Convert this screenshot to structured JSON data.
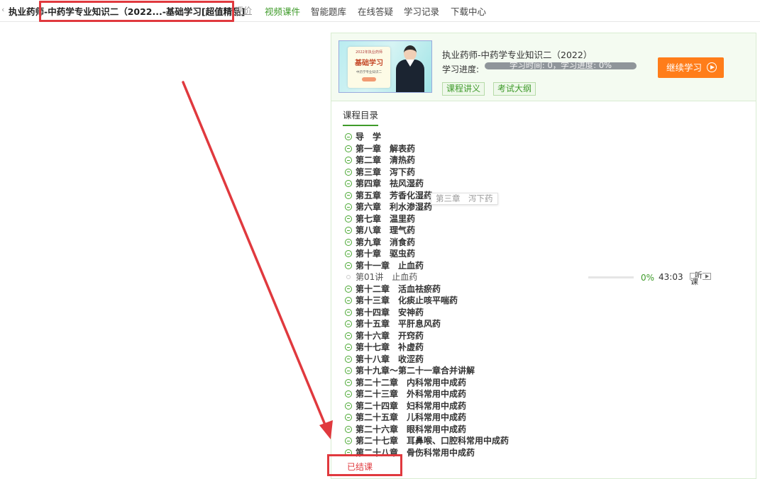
{
  "topbar": {
    "back_icon": "chevron-left-icon",
    "title": "执业药师-中药学专业知识二（2022...-基础学习[超值精品]",
    "eval": "评价",
    "nav": [
      {
        "label": "视频课件",
        "active": true
      },
      {
        "label": "智能题库",
        "active": false
      },
      {
        "label": "在线答疑",
        "active": false
      },
      {
        "label": "学习记录",
        "active": false
      },
      {
        "label": "下载中心",
        "active": false
      }
    ]
  },
  "course": {
    "thumb": {
      "line1": "2022年执业药师",
      "line2": "基础学习",
      "line3": "中药学专业知识二"
    },
    "name": "执业药师-中药学专业知识二（2022）",
    "progress_label": "学习进度:",
    "progress_text": "学习时间: 0，学习进度: 0%",
    "progress_percent": 0,
    "tags": [
      "课程讲义",
      "考试大纲"
    ],
    "continue_label": "继续学习",
    "continue_icon": "play-circle-icon"
  },
  "catalog": {
    "tab_label": "课程目录",
    "tooltip": "第三章　泻下药",
    "chapters": [
      {
        "title": "导　学"
      },
      {
        "title": "第一章　解表药"
      },
      {
        "title": "第二章　清热药"
      },
      {
        "title": "第三章　泻下药"
      },
      {
        "title": "第四章　祛风湿药"
      },
      {
        "title": "第五章　芳香化湿药"
      },
      {
        "title": "第六章　利水渗湿药"
      },
      {
        "title": "第七章　温里药"
      },
      {
        "title": "第八章　理气药"
      },
      {
        "title": "第九章　消食药"
      },
      {
        "title": "第十章　驱虫药"
      },
      {
        "title": "第十一章　止血药"
      },
      {
        "title": "第十二章　活血祛瘀药"
      },
      {
        "title": "第十三章　化痰止咳平喘药"
      },
      {
        "title": "第十四章　安神药"
      },
      {
        "title": "第十五章　平肝息风药"
      },
      {
        "title": "第十六章　开窍药"
      },
      {
        "title": "第十七章　补虚药"
      },
      {
        "title": "第十八章　收涩药"
      },
      {
        "title": "第十九章～第二十一章合并讲解"
      },
      {
        "title": "第二十二章　内科常用中成药"
      },
      {
        "title": "第二十三章　外科常用中成药"
      },
      {
        "title": "第二十四章　妇科常用中成药"
      },
      {
        "title": "第二十五章　儿科常用中成药"
      },
      {
        "title": "第二十六章　眼科常用中成药"
      },
      {
        "title": "第二十七章　耳鼻喉、口腔科常用中成药"
      },
      {
        "title": "第二十八章　骨伤科常用中成药"
      }
    ],
    "lesson": {
      "title": "第01讲　止血药",
      "percent": "0%",
      "duration": "43:03",
      "listen_top": "听",
      "listen_bottom": "课"
    },
    "finished_label": "已结课"
  },
  "colors": {
    "accent_green": "#3f9b2a",
    "orange": "#ff7d1a",
    "annotation_red": "#e0393e"
  }
}
